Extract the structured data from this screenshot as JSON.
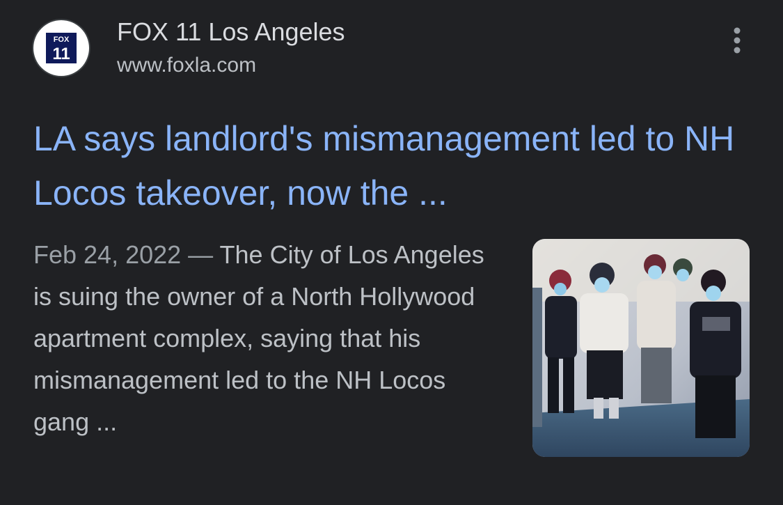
{
  "source": {
    "name": "FOX 11 Los Angeles",
    "url": "www.foxla.com",
    "favicon_brand": "FOX",
    "favicon_number": "11",
    "favicon_color": "#0f1a5a"
  },
  "more_button_icon": "more-vert-icon",
  "result": {
    "title": "LA says landlord's mismanagement led to NH Locos takeover, now the ...",
    "date": "Feb 24, 2022",
    "separator": " — ",
    "snippet": "The City of Los Angeles is suing the owner of a North Hollywood apartment complex, saying that his mismanagement led to the NH Locos gang ..."
  },
  "thumbnail": {
    "subject": "group photo of people posing, faces blurred"
  },
  "colors": {
    "background": "#202124",
    "title": "#8ab4f8",
    "text": "#bdc1c6",
    "date": "#9aa0a6"
  }
}
